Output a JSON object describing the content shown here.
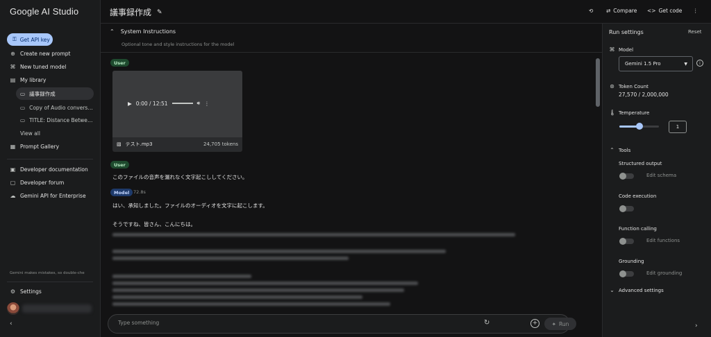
{
  "app": {
    "title": "Google AI Studio"
  },
  "sidebar": {
    "api_key_label": "Get API key",
    "items": [
      {
        "label": "Create new prompt",
        "icon": "plus-circle-icon"
      },
      {
        "label": "New tuned model",
        "icon": "tune-icon"
      },
      {
        "label": "My library",
        "icon": "library-icon"
      }
    ],
    "library": [
      {
        "label": "議事録作成"
      },
      {
        "label": "Copy of Audio conversati..."
      },
      {
        "label": "TITLE: Distance Between ..."
      }
    ],
    "view_all": "View all",
    "gallery": "Prompt Gallery",
    "links": [
      {
        "label": "Developer documentation"
      },
      {
        "label": "Developer forum"
      },
      {
        "label": "Gemini API for Enterprise"
      }
    ],
    "disclaimer": "Gemini makes mistakes, so double-che",
    "settings": "Settings"
  },
  "header": {
    "prompt_title": "議事録作成",
    "compare_label": "Compare",
    "get_code_label": "Get code"
  },
  "system_instructions": {
    "title": "System Instructions",
    "placeholder": "Optional tone and style instructions for the model"
  },
  "messages": {
    "user_badge": "User",
    "model_badge": "Model",
    "audio": {
      "time": "0:00 / 12:51",
      "filename": "テスト.mp3",
      "tokens": "24,705 tokens"
    },
    "user_text": "このファイルの音声を漏れなく文字起こししてください。",
    "model_time": "72.8s",
    "model_line1": "はい、承知しました。ファイルのオーディオを文字に起こします。",
    "model_line2": "そうですね、皆さん、こんにちは。"
  },
  "input": {
    "placeholder": "Type something",
    "run_label": "Run"
  },
  "run_settings": {
    "title": "Run settings",
    "reset": "Reset",
    "model_label": "Model",
    "model_value": "Gemini 1.5 Pro",
    "token_label": "Token Count",
    "token_value": "27,570 / 2,000,000",
    "temperature_label": "Temperature",
    "temperature_value": "1",
    "temperature_fraction": 0.5,
    "tools_label": "Tools",
    "tools": [
      {
        "name": "Structured output",
        "action": "Edit schema"
      },
      {
        "name": "Code execution",
        "action": ""
      },
      {
        "name": "Function calling",
        "action": "Edit functions"
      },
      {
        "name": "Grounding",
        "action": "Edit grounding"
      }
    ],
    "advanced": "Advanced settings"
  },
  "colors": {
    "accent": "#a8c7fa",
    "user_badge": "#1e4a2e",
    "model_badge": "#1e3a6b"
  }
}
